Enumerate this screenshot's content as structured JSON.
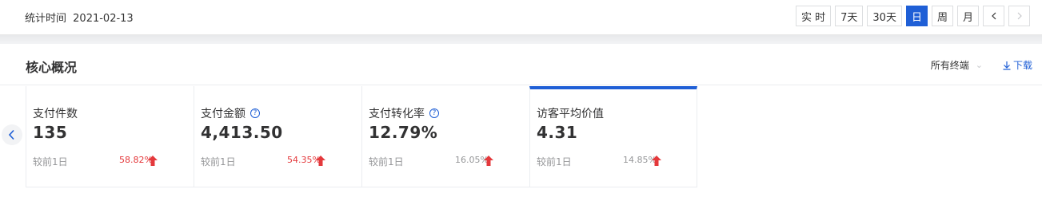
{
  "stat": {
    "label": "统计时间",
    "date": "2021-02-13"
  },
  "range_buttons": [
    {
      "label": "实 时",
      "active": false
    },
    {
      "label": "7天",
      "active": false
    },
    {
      "label": "30天",
      "active": false
    },
    {
      "label": "日",
      "active": true
    },
    {
      "label": "周",
      "active": false
    },
    {
      "label": "月",
      "active": false
    }
  ],
  "overview": {
    "title": "核心概况",
    "terminal": "所有终端",
    "download": "下载"
  },
  "cards": [
    {
      "label": "支付件数",
      "value": "135",
      "compare": "较前1日",
      "change": "58.82%"
    },
    {
      "label": "支付金额",
      "value": "4,413.50",
      "compare": "较前1日",
      "change": "54.35%"
    },
    {
      "label": "支付转化率",
      "value": "12.79%",
      "compare": "较前1日",
      "change": "16.05%"
    },
    {
      "label": "访客平均价值",
      "value": "4.31",
      "compare": "较前1日",
      "change": "14.85%"
    }
  ],
  "colors": {
    "accent": "#1f5fd6",
    "up": "#e4393c"
  }
}
